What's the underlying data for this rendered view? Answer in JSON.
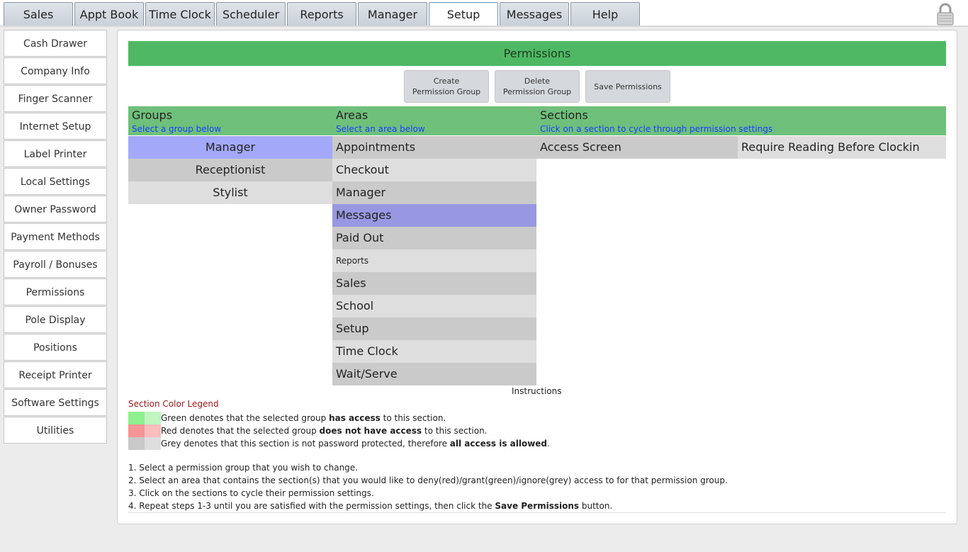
{
  "tabs": [
    {
      "label": "Sales",
      "active": false
    },
    {
      "label": "Appt Book",
      "active": false
    },
    {
      "label": "Time Clock",
      "active": false
    },
    {
      "label": "Scheduler",
      "active": false
    },
    {
      "label": "Reports",
      "active": false
    },
    {
      "label": "Manager",
      "active": false
    },
    {
      "label": "Setup",
      "active": true
    },
    {
      "label": "Messages",
      "active": false
    },
    {
      "label": "Help",
      "active": false
    }
  ],
  "sidebar": {
    "items": [
      {
        "label": "Cash Drawer"
      },
      {
        "label": "Company Info"
      },
      {
        "label": "Finger Scanner"
      },
      {
        "label": "Internet Setup"
      },
      {
        "label": "Label Printer"
      },
      {
        "label": "Local Settings"
      },
      {
        "label": "Owner Password"
      },
      {
        "label": "Payment Methods"
      },
      {
        "label": "Payroll / Bonuses"
      },
      {
        "label": "Permissions"
      },
      {
        "label": "Pole Display"
      },
      {
        "label": "Positions"
      },
      {
        "label": "Receipt Printer"
      },
      {
        "label": "Software Settings"
      },
      {
        "label": "Utilities"
      }
    ]
  },
  "permissions": {
    "title": "Permissions",
    "buttons": {
      "create": "Create Permission Group",
      "delete": "Delete Permission Group",
      "save": "Save Permissions"
    },
    "columns": {
      "groups": {
        "title": "Groups",
        "subtitle": "Select a group below"
      },
      "areas": {
        "title": "Areas",
        "subtitle": "Select an area below"
      },
      "sections": {
        "title": "Sections",
        "subtitle": "Click on a section to cycle through permission settings"
      }
    },
    "groups": [
      {
        "label": "Manager",
        "selected": true
      },
      {
        "label": "Receptionist",
        "selected": false
      },
      {
        "label": "Stylist",
        "selected": false
      }
    ],
    "areas": [
      {
        "label": "Appointments",
        "selected": false
      },
      {
        "label": "Checkout",
        "selected": false
      },
      {
        "label": "Manager",
        "selected": false
      },
      {
        "label": "Messages",
        "selected": true
      },
      {
        "label": "Paid Out",
        "selected": false
      },
      {
        "label": "Reports",
        "selected": false
      },
      {
        "label": "Sales",
        "selected": false
      },
      {
        "label": "School",
        "selected": false
      },
      {
        "label": "Setup",
        "selected": false
      },
      {
        "label": "Time Clock",
        "selected": false
      },
      {
        "label": "Wait/Serve",
        "selected": false
      }
    ],
    "sections": [
      {
        "label": "Access Screen",
        "state": "grey"
      },
      {
        "label": "Require Reading Before Clockin",
        "state": "grey"
      }
    ]
  },
  "legend": {
    "instructions_title": "Instructions",
    "title": "Section Color Legend",
    "colors": {
      "green_a": "#8ef08e",
      "green_b": "#bff5bf",
      "red_a": "#f59595",
      "red_b": "#fbbcbc",
      "grey_a": "#c9c9c9",
      "grey_b": "#dedede"
    },
    "rows": [
      {
        "pre": "Green denotes that the selected group ",
        "bold": "has access",
        "post": " to this section."
      },
      {
        "pre": "Red denotes that the selected group ",
        "bold": "does not have access",
        "post": " to this section."
      },
      {
        "pre": "Grey denotes that this section is not password protected, therefore ",
        "bold": "all access is allowed",
        "post": "."
      }
    ]
  },
  "steps": [
    {
      "pre": "1. Select a permission group that you wish to change.",
      "bold": "",
      "post": ""
    },
    {
      "pre": "2. Select an area that contains the section(s) that you would like to deny(red)/grant(green)/ignore(grey) access to for that permission group.",
      "bold": "",
      "post": ""
    },
    {
      "pre": "3. Click on the sections to cycle their permission settings.",
      "bold": "",
      "post": ""
    },
    {
      "pre": "4. Repeat steps 1-3 until you are satisfied with the permission settings, then click the ",
      "bold": "Save Permissions",
      "post": " button."
    }
  ]
}
